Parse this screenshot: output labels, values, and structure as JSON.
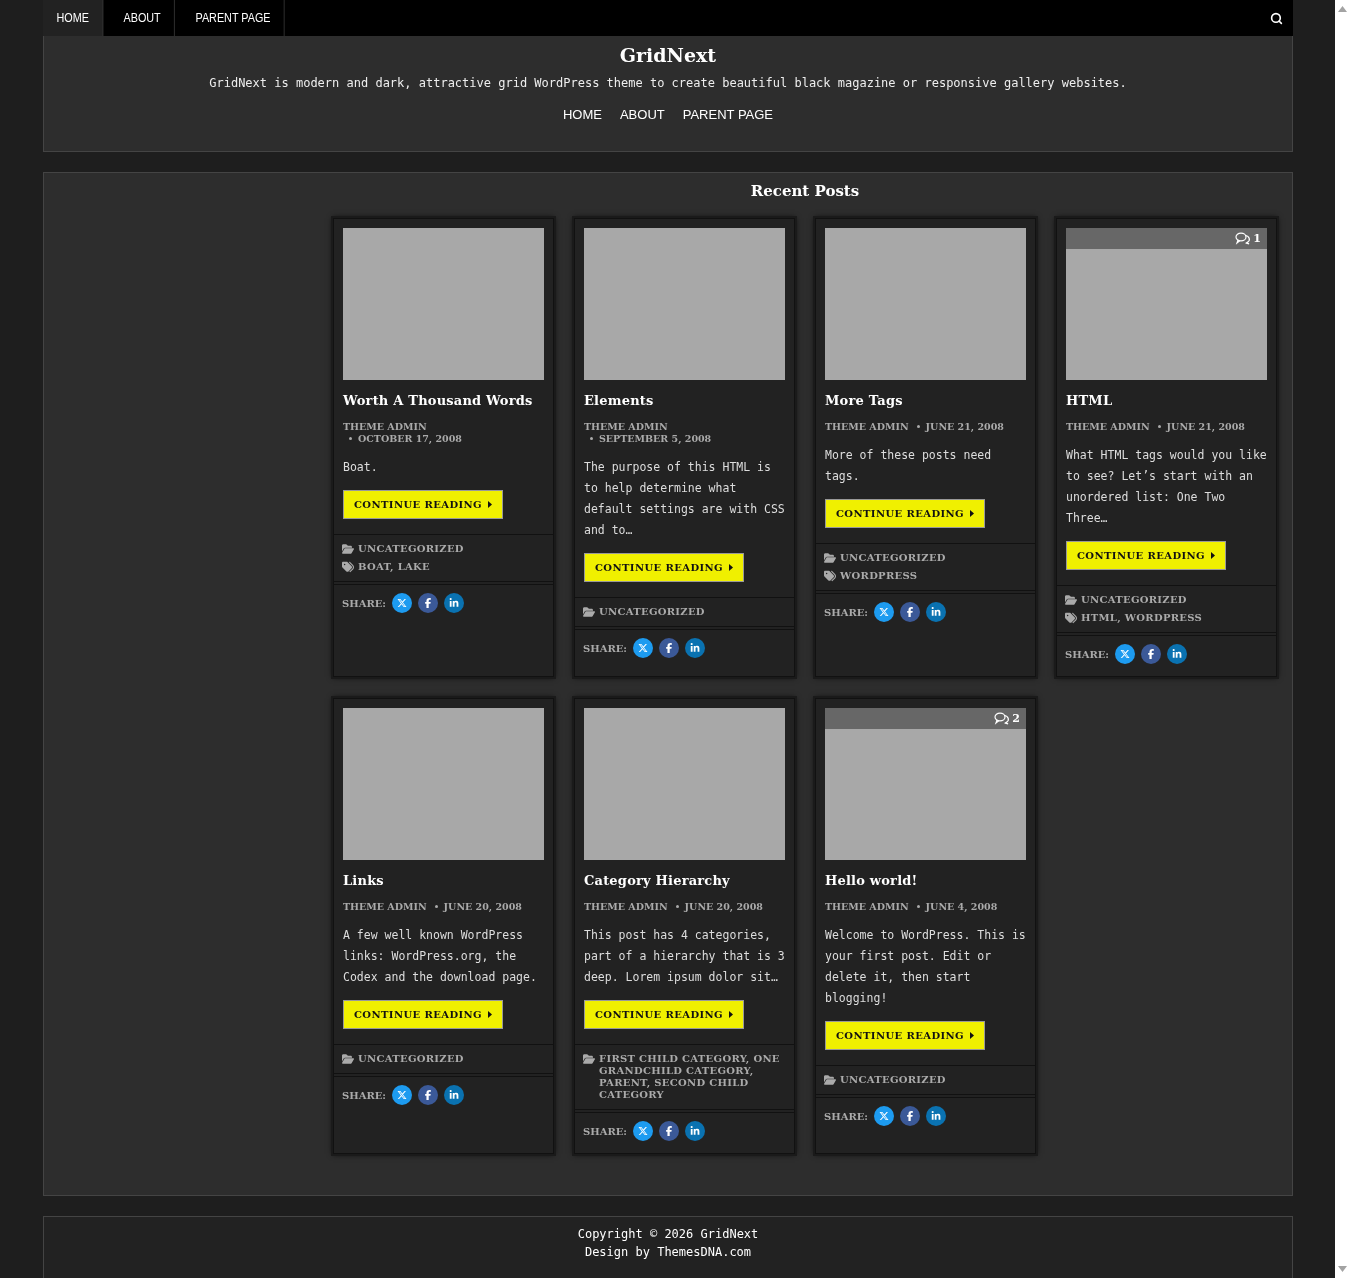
{
  "top_menu": [
    {
      "label": "HOME",
      "selected": true
    },
    {
      "label": "ABOUT",
      "selected": false
    },
    {
      "label": "PARENT PAGE",
      "selected": false
    }
  ],
  "site": {
    "title": "GridNext",
    "tagline": "GridNext is modern and dark, attractive grid WordPress theme to create beautiful black magazine or responsive gallery websites."
  },
  "header_menu": [
    "HOME",
    "ABOUT",
    "PARENT PAGE"
  ],
  "section_title": "Recent Posts",
  "posts": [
    {
      "title": "Worth A Thousand Words",
      "author": "THEME ADMIN",
      "date": "OCTOBER 17, 2008",
      "excerpt": "Boat.",
      "button": "CONTINUE READING",
      "categories": "UNCATEGORIZED",
      "tags": "BOAT, LAKE",
      "share": "SHARE:"
    },
    {
      "title": "Elements",
      "author": "THEME ADMIN",
      "date": "SEPTEMBER 5, 2008",
      "excerpt": "The purpose of this HTML is to help determine what default settings are with CSS and to…",
      "button": "CONTINUE READING",
      "categories": "UNCATEGORIZED",
      "share": "SHARE:"
    },
    {
      "title": "More Tags",
      "author": "THEME ADMIN",
      "date": "JUNE 21, 2008",
      "excerpt": "More of these posts need tags.",
      "button": "CONTINUE READING",
      "categories": "UNCATEGORIZED",
      "tags": "WORDPRESS",
      "share": "SHARE:"
    },
    {
      "title": "HTML",
      "author": "THEME ADMIN",
      "date": "JUNE 21, 2008",
      "comments": "1",
      "excerpt": "What HTML tags would you like to see? Let’s start with an unordered list: One Two Three…",
      "button": "CONTINUE READING",
      "categories": "UNCATEGORIZED",
      "tags": "HTML, WORDPRESS",
      "share": "SHARE:"
    },
    {
      "title": "Links",
      "author": "THEME ADMIN",
      "date": "JUNE 20, 2008",
      "excerpt": "A few well known WordPress links: WordPress.org, the Codex and the download page.",
      "button": "CONTINUE READING",
      "categories": "UNCATEGORIZED",
      "share": "SHARE:"
    },
    {
      "title": "Category Hierarchy",
      "author": "THEME ADMIN",
      "date": "JUNE 20, 2008",
      "excerpt": "This post has 4 categories, part of a hierarchy that is 3 deep. Lorem ipsum dolor sit…",
      "button": "CONTINUE READING",
      "categories": "FIRST CHILD CATEGORY, ONE GRANDCHILD CATEGORY, PARENT, SECOND CHILD CATEGORY",
      "share": "SHARE:"
    },
    {
      "title": "Hello world!",
      "author": "THEME ADMIN",
      "date": "JUNE 4, 2008",
      "comments": "2",
      "excerpt": "Welcome to WordPress. This is your first post. Edit or delete it, then start blogging!",
      "button": "CONTINUE READING",
      "categories": "UNCATEGORIZED",
      "share": "SHARE:"
    }
  ],
  "footer": {
    "copyright": "Copyright © 2026 GridNext",
    "credit": "Design by ThemesDNA.com"
  }
}
